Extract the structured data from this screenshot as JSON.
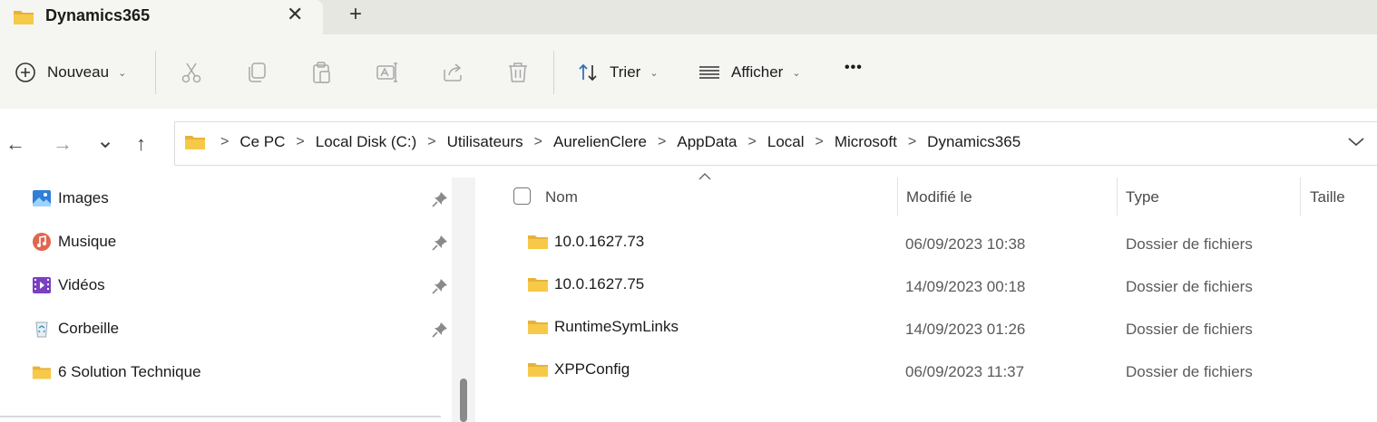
{
  "window": {
    "tab_title": "Dynamics365",
    "close_glyph": "✕",
    "new_tab_glyph": "+"
  },
  "toolbar": {
    "new_label": "Nouveau",
    "sort_label": "Trier",
    "view_label": "Afficher",
    "more_glyph": "•••",
    "icons": [
      "cut-icon",
      "copy-icon",
      "paste-icon",
      "rename-icon",
      "share-icon",
      "delete-icon"
    ]
  },
  "nav": {
    "back_glyph": "←",
    "forward_glyph": "→",
    "recent_glyph": "⌄",
    "up_glyph": "↑"
  },
  "breadcrumb": [
    "Ce PC",
    "Local Disk (C:)",
    "Utilisateurs",
    "AurelienClere",
    "AppData",
    "Local",
    "Microsoft",
    "Dynamics365"
  ],
  "breadcrumb_separator": ">",
  "sidebar": {
    "items": [
      {
        "label": "Images",
        "icon": "images-icon",
        "pinned": true
      },
      {
        "label": "Musique",
        "icon": "music-icon",
        "pinned": true
      },
      {
        "label": "Vidéos",
        "icon": "videos-icon",
        "pinned": true
      },
      {
        "label": "Corbeille",
        "icon": "recycle-bin-icon",
        "pinned": true
      },
      {
        "label": "6 Solution Technique",
        "icon": "folder-icon",
        "pinned": false
      }
    ]
  },
  "table": {
    "headers": {
      "name": "Nom",
      "modified": "Modifié le",
      "type": "Type",
      "size": "Taille"
    },
    "rows": [
      {
        "name": "10.0.1627.73",
        "modified": "06/09/2023 10:38",
        "type": "Dossier de fichiers"
      },
      {
        "name": "10.0.1627.75",
        "modified": "14/09/2023 00:18",
        "type": "Dossier de fichiers"
      },
      {
        "name": "RuntimeSymLinks",
        "modified": "14/09/2023 01:26",
        "type": "Dossier de fichiers"
      },
      {
        "name": "XPPConfig",
        "modified": "06/09/2023 11:37",
        "type": "Dossier de fichiers"
      }
    ]
  },
  "colors": {
    "titlebar": "#e7e7e2",
    "toolbar": "#f5f5f2",
    "folder": "#f7c948",
    "accent": "#2b6cb0"
  }
}
